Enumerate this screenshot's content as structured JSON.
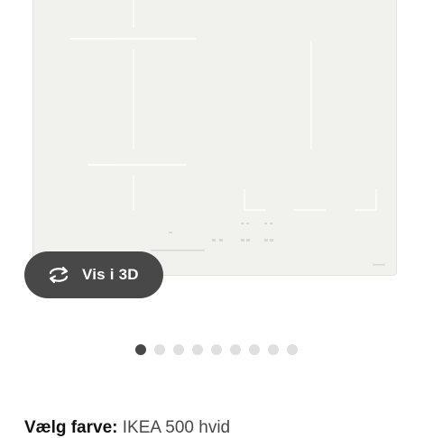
{
  "product_image": {
    "alt": "Induction cooktop, white"
  },
  "view_3d": {
    "label": "Vis i 3D",
    "icon": "rotate-3d-icon"
  },
  "carousel": {
    "total": 9,
    "active_index": 0
  },
  "color_selection": {
    "label": "Vælg farve:",
    "value": "IKEA 500 hvid"
  },
  "colors": {
    "cooktop_surface": "#f1f1ee",
    "button_bg": "#484848",
    "dot_active": "#484848",
    "dot_inactive": "#dfdfdf"
  }
}
